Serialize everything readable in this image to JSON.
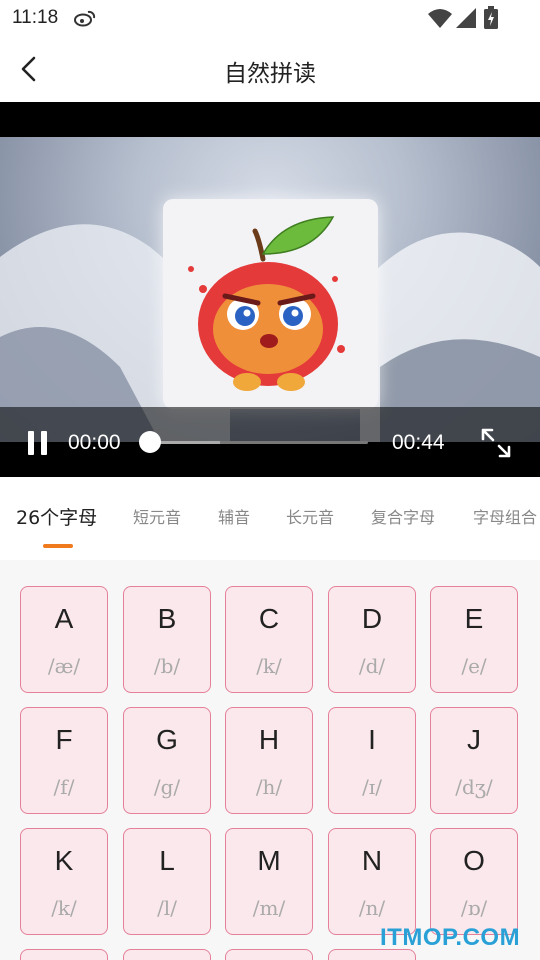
{
  "status_bar": {
    "time": "11:18"
  },
  "header": {
    "title": "自然拼读"
  },
  "video": {
    "current_time": "00:00",
    "total_time": "00:44",
    "progress": 0.0
  },
  "tabs": [
    {
      "label": "26个字母",
      "active": true
    },
    {
      "label": "短元音",
      "active": false
    },
    {
      "label": "辅音",
      "active": false
    },
    {
      "label": "长元音",
      "active": false
    },
    {
      "label": "复合字母",
      "active": false
    },
    {
      "label": "字母组合",
      "active": false
    }
  ],
  "letters": [
    {
      "letter": "A",
      "phonetic": "/æ/"
    },
    {
      "letter": "B",
      "phonetic": "/b/"
    },
    {
      "letter": "C",
      "phonetic": "/k/"
    },
    {
      "letter": "D",
      "phonetic": "/d/"
    },
    {
      "letter": "E",
      "phonetic": "/e/"
    },
    {
      "letter": "F",
      "phonetic": "/f/"
    },
    {
      "letter": "G",
      "phonetic": "/g/"
    },
    {
      "letter": "H",
      "phonetic": "/h/"
    },
    {
      "letter": "I",
      "phonetic": "/ɪ/"
    },
    {
      "letter": "J",
      "phonetic": "/dʒ/"
    },
    {
      "letter": "K",
      "phonetic": "/k/"
    },
    {
      "letter": "L",
      "phonetic": "/l/"
    },
    {
      "letter": "M",
      "phonetic": "/m/"
    },
    {
      "letter": "N",
      "phonetic": "/n/"
    },
    {
      "letter": "O",
      "phonetic": "/ɒ/"
    }
  ],
  "watermark": "ITMOP.COM",
  "colors": {
    "accent": "#f07b1e",
    "card_border": "#e5809a",
    "card_bg": "#fbe8ec"
  }
}
